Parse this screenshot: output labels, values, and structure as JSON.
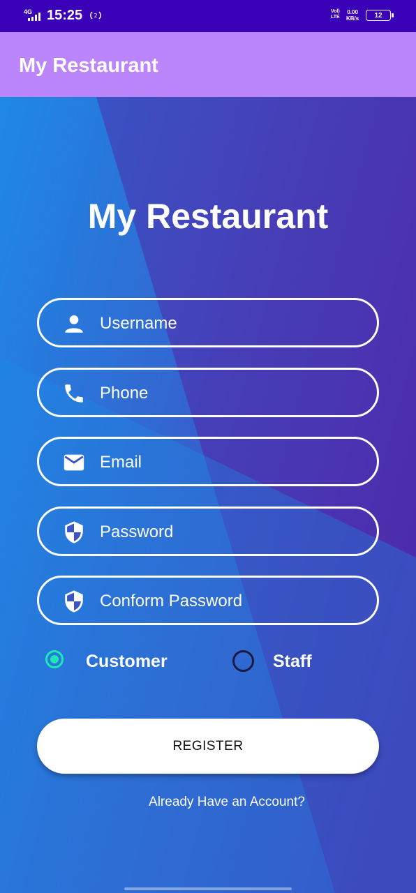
{
  "status_bar": {
    "network": "4G",
    "time": "15:25",
    "volte_top": "Vol)",
    "volte_bottom": "LTE",
    "speed_value": "0.00",
    "speed_unit": "KB/s",
    "battery": "12"
  },
  "app_bar": {
    "title": "My Restaurant"
  },
  "form": {
    "heading": "My Restaurant",
    "fields": [
      {
        "placeholder": "Username",
        "icon": "person-icon"
      },
      {
        "placeholder": "Phone",
        "icon": "phone-icon"
      },
      {
        "placeholder": "Email",
        "icon": "email-icon"
      },
      {
        "placeholder": "Password",
        "icon": "shield-icon"
      },
      {
        "placeholder": "Conform Password",
        "icon": "shield-icon"
      }
    ],
    "roles": [
      {
        "label": "Customer",
        "selected": true
      },
      {
        "label": "Staff",
        "selected": false
      }
    ],
    "register_label": "REGISTER",
    "login_link": "Already Have an Account?"
  },
  "colors": {
    "status_bar": "#3a00b8",
    "app_bar": "#bb86fc",
    "radio_selected": "#1de9b6",
    "radio_unselected": "#1a1a40"
  }
}
